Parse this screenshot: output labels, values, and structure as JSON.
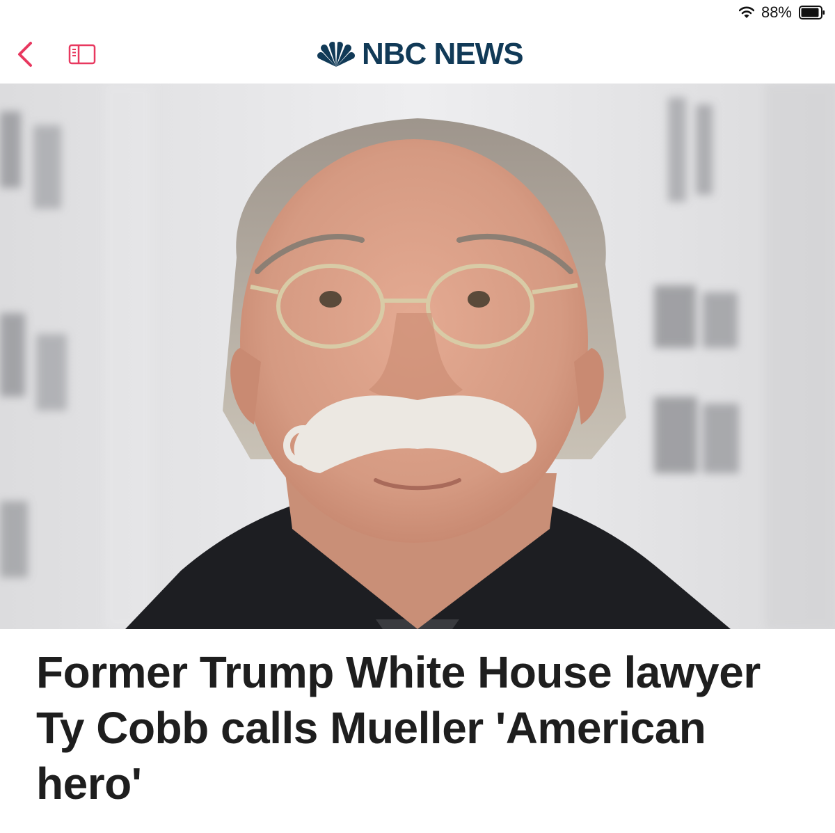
{
  "status": {
    "battery_percent": "88%",
    "icons": [
      "wifi-icon",
      "battery-icon"
    ]
  },
  "nav": {
    "back_icon": "chevron-left-icon",
    "reader_icon": "sidebar-icon",
    "brand": {
      "name": "NBC NEWS",
      "logo": "nbc-peacock-logo"
    },
    "accent_color": "#e8385f",
    "brand_color": "#113a57"
  },
  "article": {
    "headline": "Former Trump White House lawyer Ty Cobb calls Mueller 'American hero'"
  }
}
